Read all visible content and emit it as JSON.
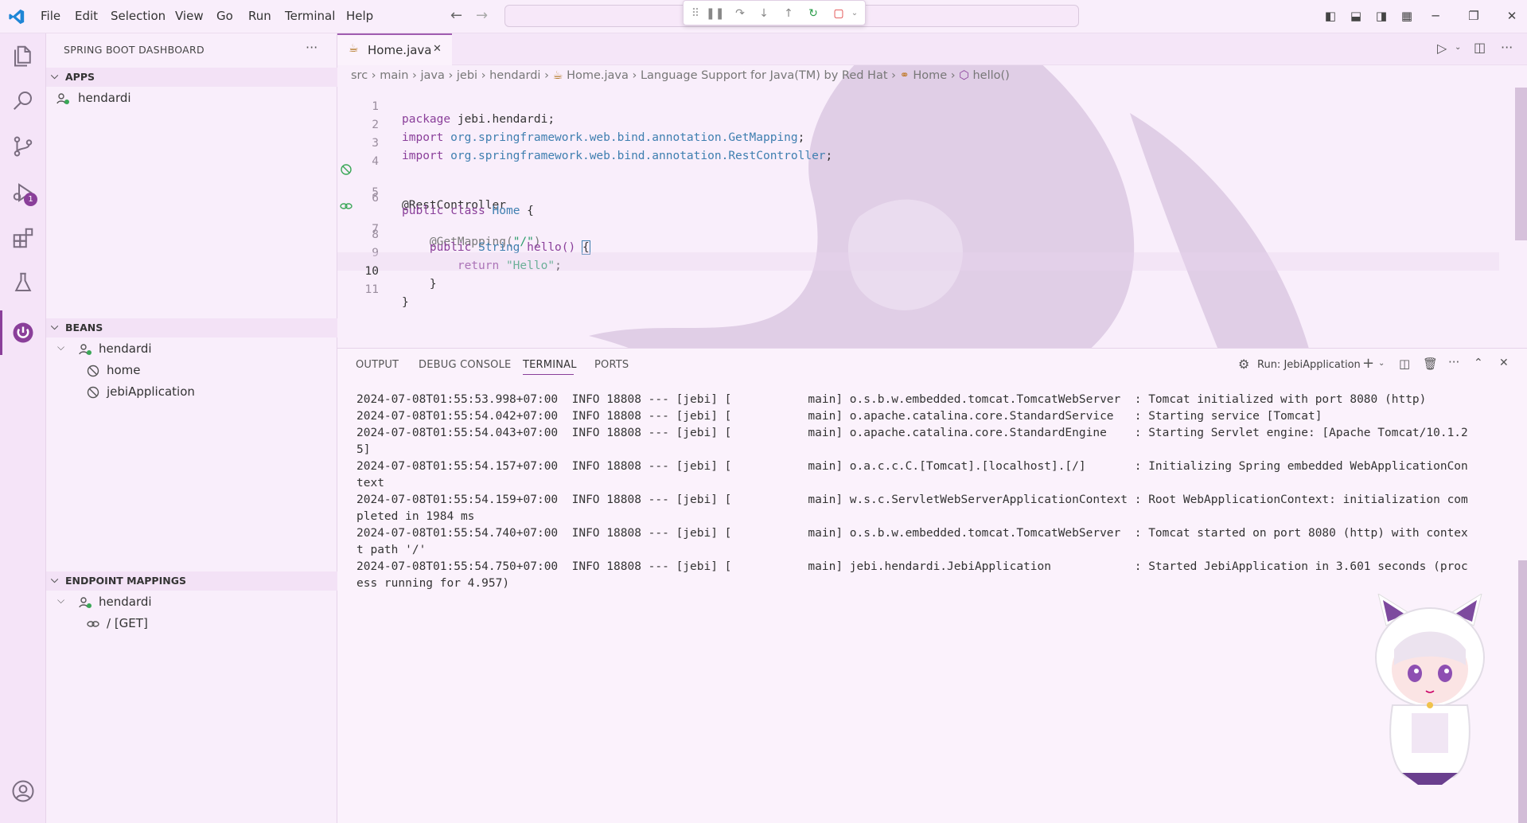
{
  "menu": [
    "File",
    "Edit",
    "Selection",
    "View",
    "Go",
    "Run",
    "Terminal",
    "Help"
  ],
  "sidebar": {
    "title": "SPRING BOOT DASHBOARD",
    "more": "···",
    "apps": {
      "label": "APPS",
      "items": [
        "hendardi"
      ]
    },
    "beans": {
      "label": "BEANS",
      "root": "hendardi",
      "items": [
        "home",
        "jebiApplication"
      ]
    },
    "endpoints": {
      "label": "ENDPOINT MAPPINGS",
      "root": "hendardi",
      "items": [
        "/ [GET]"
      ]
    }
  },
  "activity_badge": "1",
  "editor": {
    "tab": {
      "label": "Home.java",
      "close": "✕"
    },
    "breadcrumb": [
      "src",
      "main",
      "java",
      "jebi",
      "hendardi",
      "Home.java",
      "Language Support for Java(TM) by Red Hat",
      "Home",
      "hello()"
    ],
    "lines": [
      {
        "n": "1"
      },
      {
        "n": "2"
      },
      {
        "n": "3"
      },
      {
        "n": "4"
      },
      {
        "n": "5"
      },
      {
        "n": "6"
      },
      {
        "n": "7"
      },
      {
        "n": "8"
      },
      {
        "n": "9"
      },
      {
        "n": "10"
      },
      {
        "n": "11"
      }
    ],
    "code": {
      "l1a": "package ",
      "l1b": "jebi.hendardi;",
      "l2a": "import ",
      "l2b": "org.springframework.web.bind.annotation.",
      "l2c": "GetMapping",
      "l2d": ";",
      "l3a": "import ",
      "l3b": "org.springframework.web.bind.annotation.",
      "l3c": "RestController",
      "l3d": ";",
      "l5": "@RestController",
      "l6a": "public class ",
      "l6b": "Home",
      "l6c": " {",
      "l7a": "    @GetMapping(",
      "l7b": "\"/\"",
      "l7c": ")",
      "l8a": "    public ",
      "l8b": "String ",
      "l8c": "hello() ",
      "l8d": "{",
      "l9a": "        return ",
      "l9b": "\"Hello\"",
      "l9c": ";",
      "l10": "    }",
      "l11": "}"
    }
  },
  "panel": {
    "tabs": [
      "OUTPUT",
      "DEBUG CONSOLE",
      "TERMINAL",
      "PORTS"
    ],
    "run_label": "Run: JebiApplication",
    "terminal": [
      "2024-07-08T01:55:53.998+07:00  INFO 18808 --- [jebi] [           main] o.s.b.w.embedded.tomcat.TomcatWebServer  : Tomcat initialized with port 8080 (http)",
      "2024-07-08T01:55:54.042+07:00  INFO 18808 --- [jebi] [           main] o.apache.catalina.core.StandardService   : Starting service [Tomcat]",
      "2024-07-08T01:55:54.043+07:00  INFO 18808 --- [jebi] [           main] o.apache.catalina.core.StandardEngine    : Starting Servlet engine: [Apache Tomcat/10.1.2",
      "5]",
      "2024-07-08T01:55:54.157+07:00  INFO 18808 --- [jebi] [           main] o.a.c.c.C.[Tomcat].[localhost].[/]       : Initializing Spring embedded WebApplicationCon",
      "text",
      "2024-07-08T01:55:54.159+07:00  INFO 18808 --- [jebi] [           main] w.s.c.ServletWebServerApplicationContext : Root WebApplicationContext: initialization com",
      "pleted in 1984 ms",
      "2024-07-08T01:55:54.740+07:00  INFO 18808 --- [jebi] [           main] o.s.b.w.embedded.tomcat.TomcatWebServer  : Tomcat started on port 8080 (http) with contex",
      "t path '/'",
      "2024-07-08T01:55:54.750+07:00  INFO 18808 --- [jebi] [           main] jebi.hendardi.JebiApplication            : Started JebiApplication in 3.601 seconds (proc",
      "ess running for 4.957)"
    ]
  },
  "colors": {
    "accent": "#8a3f9a",
    "background": "#f9eefb",
    "spring_green": "#3aa757"
  }
}
